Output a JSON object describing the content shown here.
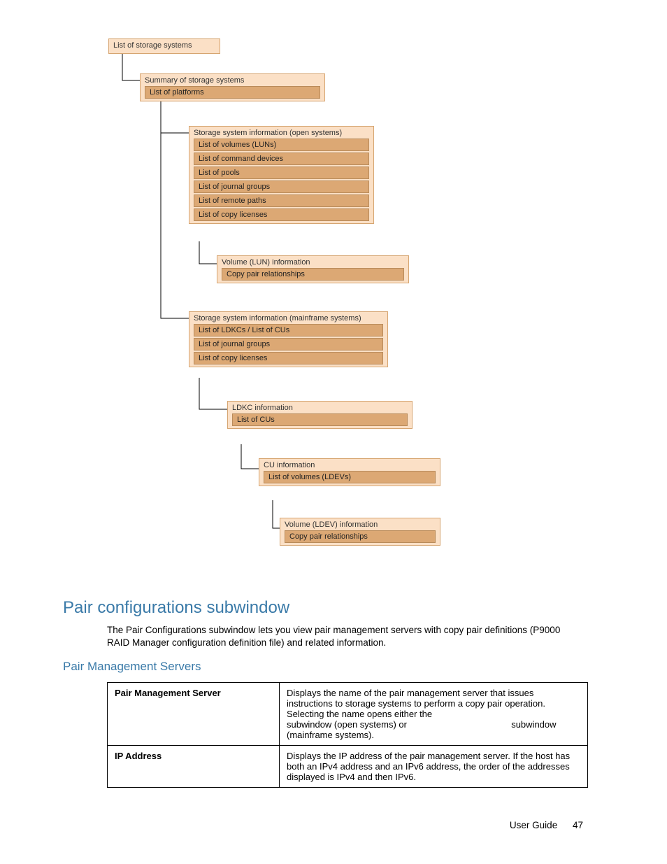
{
  "diagram": {
    "n1": {
      "title": "List of storage systems"
    },
    "n2": {
      "title": "Summary of storage systems",
      "subs": [
        "List of platforms"
      ]
    },
    "n3": {
      "title": "Storage system information (open systems)",
      "subs": [
        "List of volumes (LUNs)",
        "List of command devices",
        "List of pools",
        "List of journal groups",
        "List of remote paths",
        "List of copy licenses"
      ]
    },
    "n4": {
      "title": "Volume (LUN) information",
      "subs": [
        "Copy pair relationships"
      ]
    },
    "n5": {
      "title": "Storage system information (mainframe systems)",
      "subs": [
        "List of LDKCs / List of CUs",
        "List of journal groups",
        "List of copy licenses"
      ]
    },
    "n6": {
      "title": "LDKC information",
      "subs": [
        "List of CUs"
      ]
    },
    "n7": {
      "title": "CU information",
      "subs": [
        "List of volumes (LDEVs)"
      ]
    },
    "n8": {
      "title": "Volume (LDEV) information",
      "subs": [
        "Copy pair relationships"
      ]
    }
  },
  "headings": {
    "h1": "Pair configurations subwindow",
    "para": "The Pair Configurations subwindow lets you view pair management servers with copy pair definitions (P9000 RAID Manager configuration definition file) and related information.",
    "h2": "Pair Management Servers"
  },
  "table": {
    "r1k": "Pair Management Server",
    "r1v_a": "Displays the name of the pair management server that issues instructions to storage systems to perform a copy pair operation. Selecting the name opens either the ",
    "r1v_b": " subwindow (open systems) or ",
    "r1v_c": " subwindow (mainframe systems).",
    "r2k": "IP Address",
    "r2v": "Displays the IP address of the pair management server. If the host has both an IPv4 address and an IPv6 address, the order of the addresses displayed is IPv4 and then IPv6."
  },
  "footer": {
    "label": "User Guide",
    "page": "47"
  }
}
